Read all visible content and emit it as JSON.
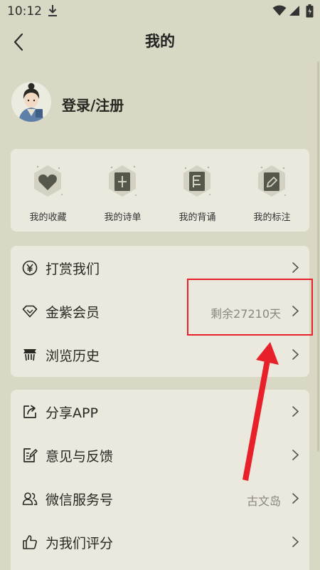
{
  "status_bar": {
    "time": "10:12"
  },
  "header": {
    "title": "我的"
  },
  "profile": {
    "login_label": "登录/注册"
  },
  "shortcuts": [
    {
      "label": "我的收藏",
      "icon": "heart-icon"
    },
    {
      "label": "我的诗单",
      "icon": "poem-list-icon"
    },
    {
      "label": "我的背诵",
      "icon": "recite-book-icon"
    },
    {
      "label": "我的标注",
      "icon": "annotate-edit-icon"
    }
  ],
  "menu_group_1": [
    {
      "label": "打赏我们",
      "icon": "yuan-coin-icon",
      "value": ""
    },
    {
      "label": "金紫会员",
      "icon": "diamond-icon",
      "value": "剩余27210天"
    },
    {
      "label": "浏览历史",
      "icon": "history-icon",
      "value": ""
    }
  ],
  "menu_group_2": [
    {
      "label": "分享APP",
      "icon": "share-icon",
      "value": ""
    },
    {
      "label": "意见与反馈",
      "icon": "feedback-icon",
      "value": ""
    },
    {
      "label": "微信服务号",
      "icon": "wechat-users-icon",
      "value": "古文岛"
    },
    {
      "label": "为我们评分",
      "icon": "thumbs-up-icon",
      "value": ""
    }
  ],
  "colors": {
    "background": "#d9d8c4",
    "card": "#ebe9de",
    "annotation": "#e8202a",
    "icon_dark": "#55564a"
  }
}
